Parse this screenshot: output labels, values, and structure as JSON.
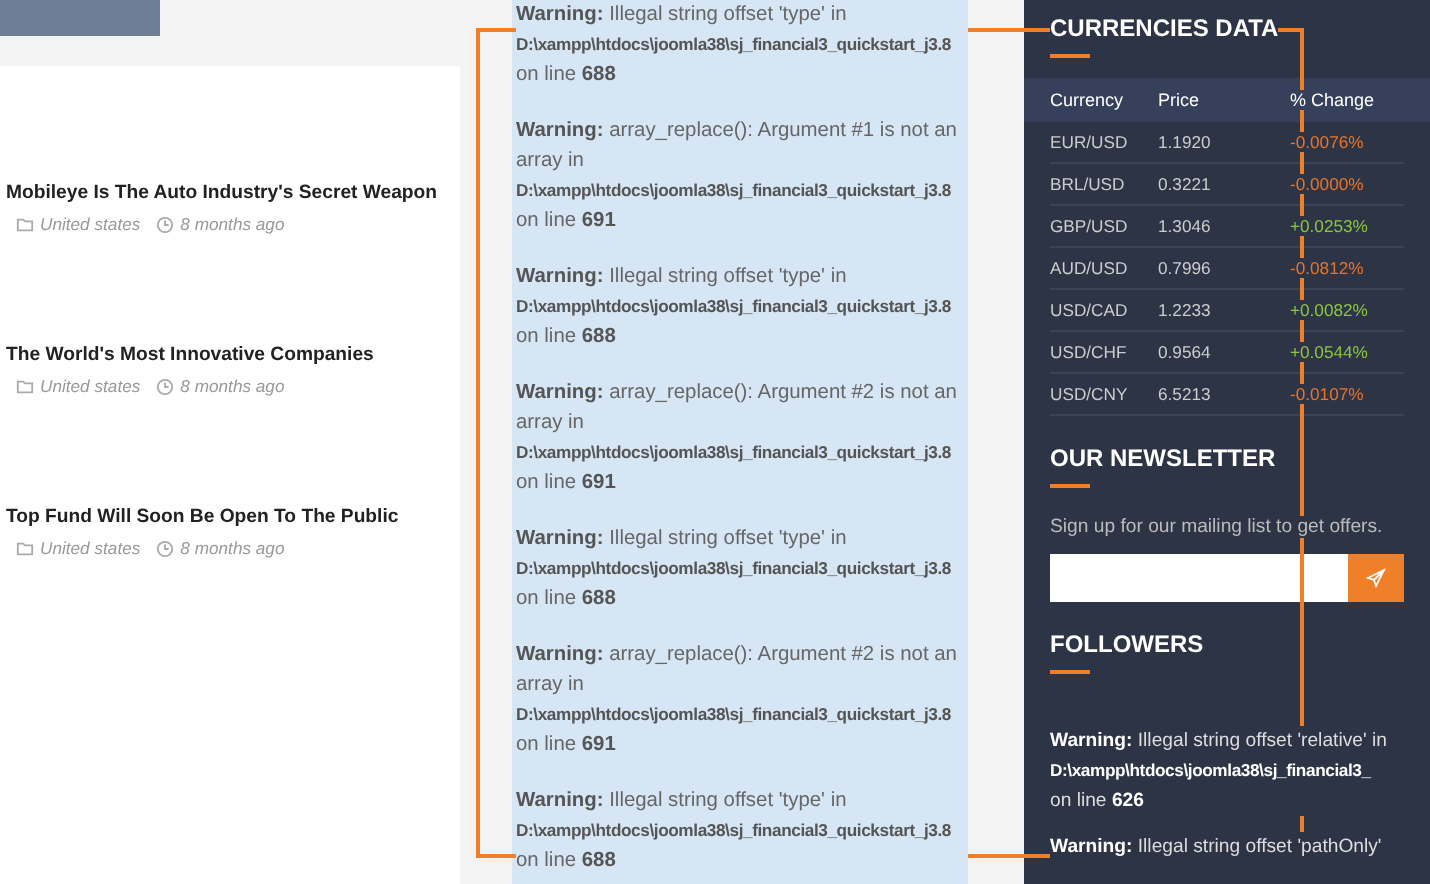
{
  "articles": [
    {
      "title": "Mobileye Is The Auto Industry's Secret Weapon",
      "category": "United states",
      "time": "8 months ago"
    },
    {
      "title": "The World's Most Innovative Companies",
      "category": "United states",
      "time": "8 months ago"
    },
    {
      "title": "Top Fund Will Soon Be Open To The Public",
      "category": "United states",
      "time": "8 months ago"
    }
  ],
  "warnings": [
    {
      "message": "**Warning:** Illegal string offset 'type' in",
      "path": "D:\\xampp\\htdocs\\joomla38\\sj_financial3_quickstart_j3.8",
      "location": "on line **688**"
    },
    {
      "message": "**Warning:** array_replace(): Argument #1 is not an array in",
      "path": "D:\\xampp\\htdocs\\joomla38\\sj_financial3_quickstart_j3.8",
      "location": "on line **691**"
    },
    {
      "message": "**Warning:** Illegal string offset 'type' in",
      "path": "D:\\xampp\\htdocs\\joomla38\\sj_financial3_quickstart_j3.8",
      "location": "on line **688**"
    },
    {
      "message": "**Warning:** array_replace(): Argument #2 is not an array in",
      "path": "D:\\xampp\\htdocs\\joomla38\\sj_financial3_quickstart_j3.8",
      "location": "on line **691**"
    },
    {
      "message": "**Warning:** Illegal string offset 'type' in",
      "path": "D:\\xampp\\htdocs\\joomla38\\sj_financial3_quickstart_j3.8",
      "location": "on line **688**"
    },
    {
      "message": "**Warning:** array_replace(): Argument #2 is not an array in",
      "path": "D:\\xampp\\htdocs\\joomla38\\sj_financial3_quickstart_j3.8",
      "location": "on line **691**"
    },
    {
      "message": "**Warning:** Illegal string offset 'type' in",
      "path": "D:\\xampp\\htdocs\\joomla38\\sj_financial3_quickstart_j3.8",
      "location": "on line **688**"
    }
  ],
  "currencies": {
    "title": "CURRENCIES DATA",
    "columns": [
      "Currency",
      "Price",
      "% Change"
    ],
    "rows": [
      {
        "pair": "EUR/USD",
        "price": "1.1920",
        "change": "-0.0076%",
        "color": "#e8742a"
      },
      {
        "pair": "BRL/USD",
        "price": "0.3221",
        "change": "-0.0000%",
        "color": "#e8742a"
      },
      {
        "pair": "GBP/USD",
        "price": "1.3046",
        "change": "+0.0253%",
        "color": "#8dc63f"
      },
      {
        "pair": "AUD/USD",
        "price": "0.7996",
        "change": "-0.0812%",
        "color": "#e8742a"
      },
      {
        "pair": "USD/CAD",
        "price": "1.2233",
        "change": "+0.0082%",
        "color": "#8dc63f"
      },
      {
        "pair": "USD/CHF",
        "price": "0.9564",
        "change": "+0.0544%",
        "color": "#8dc63f"
      },
      {
        "pair": "USD/CNY",
        "price": "6.5213",
        "change": "-0.0107%",
        "color": "#e8742a"
      }
    ]
  },
  "newsletter": {
    "title": "OUR NEWSLETTER",
    "text": "Sign up for our mailing list to get offers."
  },
  "followers": {
    "title": "FOLLOWERS",
    "warnings": [
      {
        "message": "**Warning:** Illegal string offset 'relative' in",
        "path": "D:\\xampp\\htdocs\\joomla38\\sj_financial3_",
        "location": "on line **626**"
      },
      {
        "message": "**Warning:** Illegal string offset 'pathOnly'"
      }
    ]
  }
}
